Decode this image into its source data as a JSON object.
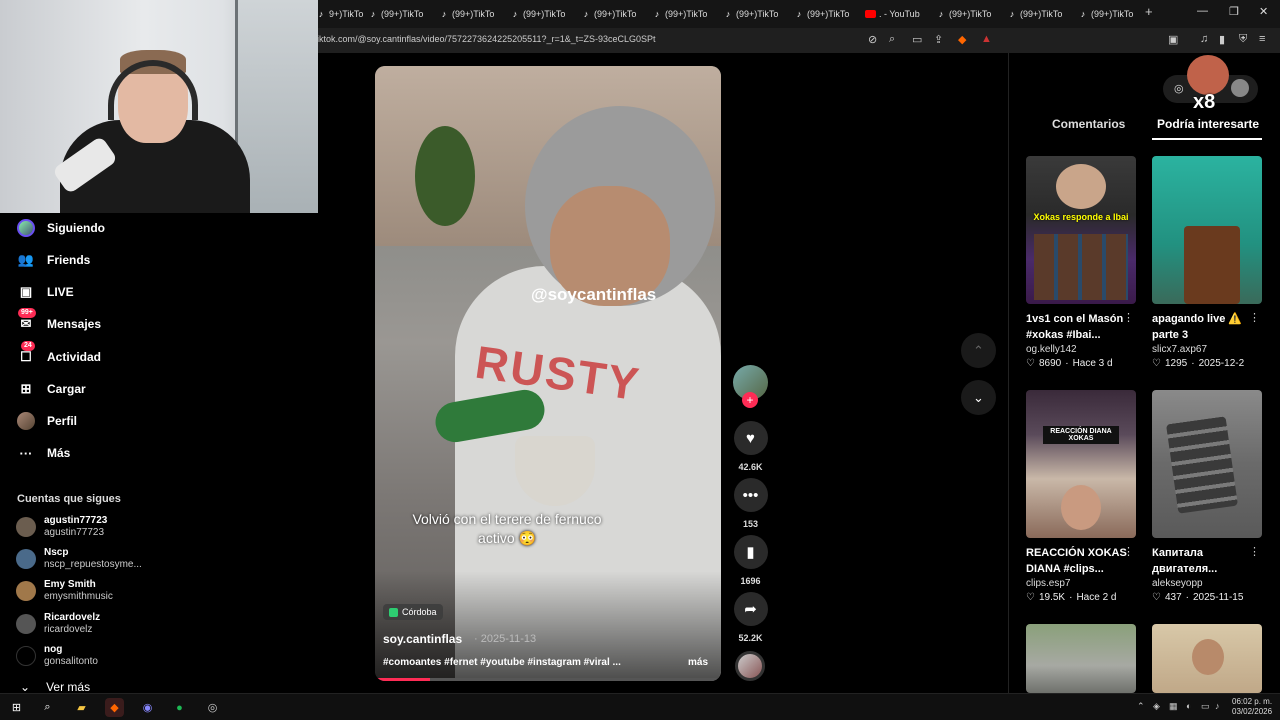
{
  "browser": {
    "tabs": [
      {
        "label": "9+)TikTo",
        "icon": "tiktok"
      },
      {
        "label": "(99+)TikTo",
        "icon": "tiktok"
      },
      {
        "label": "(99+)TikTo",
        "icon": "tiktok"
      },
      {
        "label": "(99+)TikTo",
        "icon": "tiktok"
      },
      {
        "label": "(99+)TikTo",
        "icon": "tiktok"
      },
      {
        "label": "(99+)TikTo",
        "icon": "tiktok"
      },
      {
        "label": "(99+)TikTo",
        "icon": "tiktok"
      },
      {
        "label": "(99+)TikTo",
        "icon": "tiktok"
      },
      {
        "label": ". - YouTub",
        "icon": "youtube"
      },
      {
        "label": "(99+)TikTo",
        "icon": "tiktok"
      },
      {
        "label": "(99+)TikTo",
        "icon": "tiktok"
      },
      {
        "label": "(99+)TikTo",
        "icon": "tiktok"
      }
    ],
    "new_tab": "+",
    "url": "iktok.com/@soy.cantinflas/video/7572273624225205511?_r=1&_t=ZS-93ceCLG0SPt"
  },
  "sidebar": {
    "nav": [
      {
        "label": "Siguiendo",
        "icon": "avatar-icon",
        "badge": ""
      },
      {
        "label": "Friends",
        "icon": "friends-icon",
        "badge": ""
      },
      {
        "label": "LIVE",
        "icon": "live-icon",
        "badge": ""
      },
      {
        "label": "Mensajes",
        "icon": "messages-icon",
        "badge": "99+"
      },
      {
        "label": "Actividad",
        "icon": "activity-icon",
        "badge": "24"
      },
      {
        "label": "Cargar",
        "icon": "upload-icon",
        "badge": ""
      },
      {
        "label": "Perfil",
        "icon": "profile-icon",
        "badge": ""
      },
      {
        "label": "Más",
        "icon": "more-icon",
        "badge": ""
      }
    ],
    "following_title": "Cuentas que sigues",
    "following": [
      {
        "name": "agustin77723",
        "handle": "agustin77723"
      },
      {
        "name": "Nscp",
        "handle": "nscp_repuestosyme..."
      },
      {
        "name": "Emy Smith",
        "handle": "emysmithmusic"
      },
      {
        "name": "Ricardovelz",
        "handle": "ricardovelz"
      },
      {
        "name": "nog",
        "handle": "gonsalitonto"
      }
    ],
    "see_more": "Ver más"
  },
  "video": {
    "watermark": "@soycantinflas",
    "caption": "Volvió con el tererе de fernuco activo 😳",
    "location": "Córdoba",
    "author": "soy.cantinflas",
    "date": "· 2025-11-13",
    "tags": "#comoantes #fernet #youtube #instagram #viral ...",
    "more": "más",
    "progress": 0.16
  },
  "actions": {
    "likes": "42.6K",
    "comments": "153",
    "saves": "1696",
    "shares": "52.2K"
  },
  "right_panel": {
    "overlay": "x8",
    "tabs": [
      "Comentarios",
      "Podría interesarte"
    ],
    "active_tab": "Podría interesarte",
    "cards": [
      {
        "title": "1vs1 con el Masón #xokas #Ibai...",
        "author": "og.kelly142",
        "likes": "8690",
        "date": "Hace 3 d",
        "thumb_text": "Xokas responde a Ibai"
      },
      {
        "title": "apagando live ⚠️ parte 3",
        "author": "slicx7.axp67",
        "likes": "1295",
        "date": "2025-12-2",
        "thumb_text": ""
      },
      {
        "title": "REACCIÓN XOKAS DIANA #clips...",
        "author": "clips.esp7",
        "likes": "19.5K",
        "date": "Hace 2 d",
        "thumb_text": "REACCIÓN DIANA XOKAS"
      },
      {
        "title": "Капитала двигателя...",
        "author": "alekseyopp",
        "likes": "437",
        "date": "2025-11-15",
        "thumb_text": ""
      }
    ]
  },
  "taskbar": {
    "time": "06:02 p. m.",
    "date": "03/02/2026"
  }
}
